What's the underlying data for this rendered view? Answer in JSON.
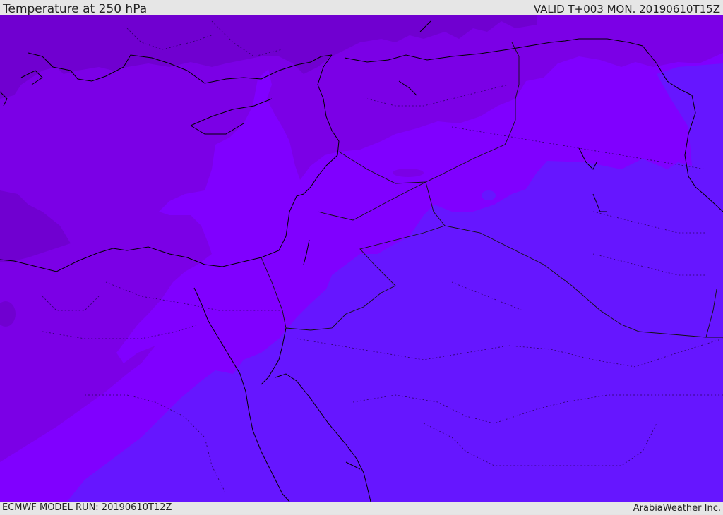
{
  "header": {
    "title": "Temperature at 250 hPa",
    "valid": "VALID T+003 MON. 20190610T15Z"
  },
  "footer": {
    "model_run": "ECMWF MODEL RUN: 20190610T12Z",
    "credit": "ArabiaWeather Inc."
  },
  "colors": {
    "coldest_band": "#7000d0",
    "cold_band": "#7b00e6",
    "mid_band": "#8000ff",
    "warm_band": "#6616ff",
    "coast_line": "#000000",
    "border_line": "#2a0060"
  }
}
